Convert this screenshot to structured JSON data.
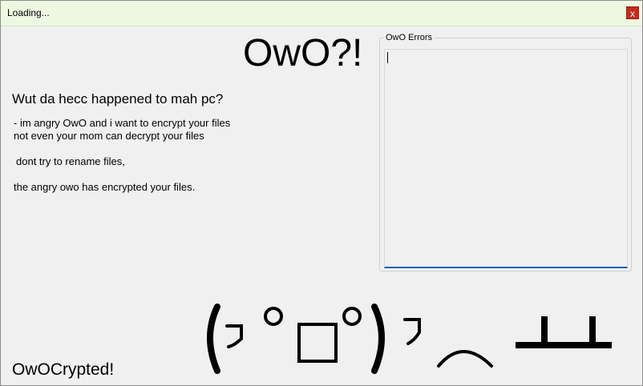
{
  "window": {
    "title": "Loading...",
    "close_label": "x"
  },
  "main": {
    "big_title": "OwO?!",
    "heading": "Wut da hecc happened to mah pc?",
    "lines": [
      "- im angry OwO and i want to encrypt your files",
      "not even your mom can decrypt your files",
      "dont try to rename files,",
      "the angry owo has encrypted your files."
    ],
    "footer": "OwOCrypted!",
    "emoticon": "(╯°□°)╯︵ ┻━┻"
  },
  "errors_box": {
    "label": "OwO Errors",
    "value": ""
  },
  "colors": {
    "titlebar": "#eef7e2",
    "close": "#c42b1c",
    "textarea_focus": "#0063b1"
  }
}
